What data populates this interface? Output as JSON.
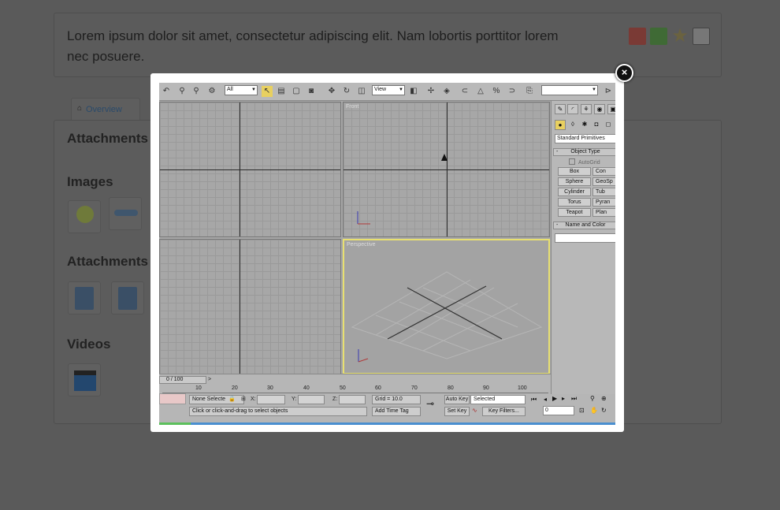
{
  "page": {
    "lead": "Lorem ipsum dolor sit amet, consectetur adipiscing elit. Nam lobortis porttitor lorem nec posuere.",
    "doc_icons": [
      "pdf-icon",
      "xls-icon",
      "star-icon",
      "mail-icon"
    ],
    "tab_label": "Overview",
    "sections": [
      "Attachments",
      "Images",
      "Attachments",
      "Videos"
    ]
  },
  "modal": {
    "close_glyph": "×",
    "app": {
      "toolbar": {
        "filter_value": "All",
        "refcoord_value": "View",
        "named_sel_value": ""
      },
      "viewports": {
        "top_left": "",
        "top_right": "Front",
        "bottom_left": "",
        "bottom_right": "Perspective"
      },
      "panel": {
        "category": "Standard Primitives",
        "rollout_object_type": "Object Type",
        "autogrid": "AutoGrid",
        "buttons_left": [
          "Box",
          "Sphere",
          "Cylinder",
          "Torus",
          "Teapot"
        ],
        "buttons_right": [
          "Con",
          "GeoSp",
          "Tub",
          "Pyran",
          "Plan"
        ],
        "rollout_name_color": "Name and Color",
        "collapse_glyph": "-"
      },
      "timeline": {
        "slider": "0 / 100",
        "slider_arrow": ">",
        "ticks": [
          "10",
          "20",
          "30",
          "40",
          "50",
          "60",
          "70",
          "80",
          "90",
          "100"
        ]
      },
      "status": {
        "selection": "None Selecte",
        "x_label": "X:",
        "y_label": "Y:",
        "z_label": "Z:",
        "grid": "Grid = 10.0",
        "add_time_tag": "Add Time Tag",
        "prompt": "Click or click-and-drag to select objects",
        "auto_key": "Auto Key",
        "set_key": "Set Key",
        "selected_option": "Selected",
        "key_filters": "Key Filters...",
        "frame": "0"
      }
    }
  }
}
